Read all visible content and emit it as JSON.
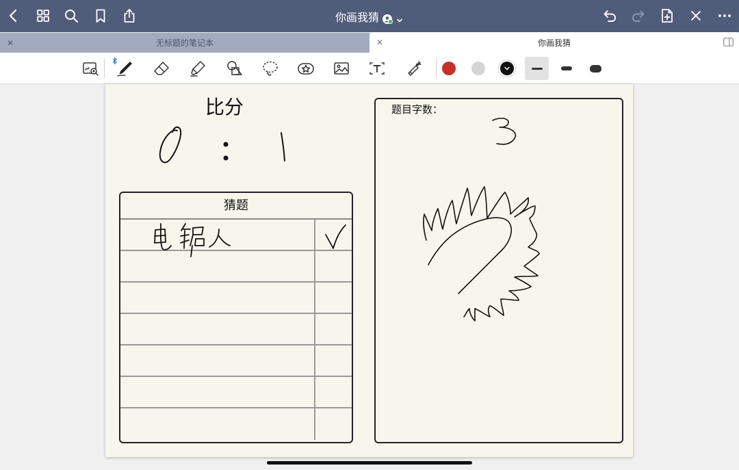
{
  "topbar": {
    "title": "你画我猜",
    "icons": [
      "back-icon",
      "grid-icon",
      "search-icon",
      "bookmark-icon",
      "share-icon",
      "undo-icon",
      "redo-icon",
      "add-page-icon",
      "close-icon",
      "more-icon"
    ]
  },
  "tabs": [
    {
      "label": "无标题的笔记本",
      "active": false
    },
    {
      "label": "你画我猜",
      "active": true
    }
  ],
  "toolbar": {
    "tools": [
      "zoom-window-tool",
      "pen-tool",
      "eraser-tool",
      "highlighter-tool",
      "shapes-tool",
      "lasso-tool",
      "sticker-tool",
      "image-tool",
      "text-tool",
      "laser-pointer-tool"
    ],
    "colors": [
      "#c6302a",
      "#d4d4d4",
      "#111111"
    ],
    "selected_color": "#111111",
    "stroke_widths": [
      "thin",
      "medium",
      "thick"
    ],
    "selected_stroke": "thin"
  },
  "page": {
    "score_title": "比分",
    "score_left": "0",
    "score_right": "1",
    "guess_header": "猜题",
    "guess_rows": 7,
    "first_guess": "电锯人",
    "first_guess_result": "correct",
    "count_label": "题目字数：",
    "count_value": "3"
  },
  "colors": {
    "topbar": "#4f5c7a",
    "page": "#f6f6ec",
    "ink": "#111111"
  }
}
